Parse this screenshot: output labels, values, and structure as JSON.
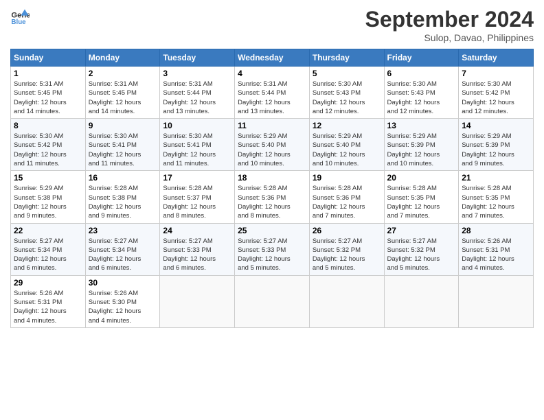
{
  "header": {
    "logo_line1": "General",
    "logo_line2": "Blue",
    "month": "September 2024",
    "location": "Sulop, Davao, Philippines"
  },
  "weekdays": [
    "Sunday",
    "Monday",
    "Tuesday",
    "Wednesday",
    "Thursday",
    "Friday",
    "Saturday"
  ],
  "weeks": [
    [
      {
        "day": "1",
        "sunrise": "5:31 AM",
        "sunset": "5:45 PM",
        "daylight": "12 hours and 14 minutes."
      },
      {
        "day": "2",
        "sunrise": "5:31 AM",
        "sunset": "5:45 PM",
        "daylight": "12 hours and 14 minutes."
      },
      {
        "day": "3",
        "sunrise": "5:31 AM",
        "sunset": "5:44 PM",
        "daylight": "12 hours and 13 minutes."
      },
      {
        "day": "4",
        "sunrise": "5:31 AM",
        "sunset": "5:44 PM",
        "daylight": "12 hours and 13 minutes."
      },
      {
        "day": "5",
        "sunrise": "5:30 AM",
        "sunset": "5:43 PM",
        "daylight": "12 hours and 12 minutes."
      },
      {
        "day": "6",
        "sunrise": "5:30 AM",
        "sunset": "5:43 PM",
        "daylight": "12 hours and 12 minutes."
      },
      {
        "day": "7",
        "sunrise": "5:30 AM",
        "sunset": "5:42 PM",
        "daylight": "12 hours and 12 minutes."
      }
    ],
    [
      {
        "day": "8",
        "sunrise": "5:30 AM",
        "sunset": "5:42 PM",
        "daylight": "12 hours and 11 minutes."
      },
      {
        "day": "9",
        "sunrise": "5:30 AM",
        "sunset": "5:41 PM",
        "daylight": "12 hours and 11 minutes."
      },
      {
        "day": "10",
        "sunrise": "5:30 AM",
        "sunset": "5:41 PM",
        "daylight": "12 hours and 11 minutes."
      },
      {
        "day": "11",
        "sunrise": "5:29 AM",
        "sunset": "5:40 PM",
        "daylight": "12 hours and 10 minutes."
      },
      {
        "day": "12",
        "sunrise": "5:29 AM",
        "sunset": "5:40 PM",
        "daylight": "12 hours and 10 minutes."
      },
      {
        "day": "13",
        "sunrise": "5:29 AM",
        "sunset": "5:39 PM",
        "daylight": "12 hours and 10 minutes."
      },
      {
        "day": "14",
        "sunrise": "5:29 AM",
        "sunset": "5:39 PM",
        "daylight": "12 hours and 9 minutes."
      }
    ],
    [
      {
        "day": "15",
        "sunrise": "5:29 AM",
        "sunset": "5:38 PM",
        "daylight": "12 hours and 9 minutes."
      },
      {
        "day": "16",
        "sunrise": "5:28 AM",
        "sunset": "5:38 PM",
        "daylight": "12 hours and 9 minutes."
      },
      {
        "day": "17",
        "sunrise": "5:28 AM",
        "sunset": "5:37 PM",
        "daylight": "12 hours and 8 minutes."
      },
      {
        "day": "18",
        "sunrise": "5:28 AM",
        "sunset": "5:36 PM",
        "daylight": "12 hours and 8 minutes."
      },
      {
        "day": "19",
        "sunrise": "5:28 AM",
        "sunset": "5:36 PM",
        "daylight": "12 hours and 7 minutes."
      },
      {
        "day": "20",
        "sunrise": "5:28 AM",
        "sunset": "5:35 PM",
        "daylight": "12 hours and 7 minutes."
      },
      {
        "day": "21",
        "sunrise": "5:28 AM",
        "sunset": "5:35 PM",
        "daylight": "12 hours and 7 minutes."
      }
    ],
    [
      {
        "day": "22",
        "sunrise": "5:27 AM",
        "sunset": "5:34 PM",
        "daylight": "12 hours and 6 minutes."
      },
      {
        "day": "23",
        "sunrise": "5:27 AM",
        "sunset": "5:34 PM",
        "daylight": "12 hours and 6 minutes."
      },
      {
        "day": "24",
        "sunrise": "5:27 AM",
        "sunset": "5:33 PM",
        "daylight": "12 hours and 6 minutes."
      },
      {
        "day": "25",
        "sunrise": "5:27 AM",
        "sunset": "5:33 PM",
        "daylight": "12 hours and 5 minutes."
      },
      {
        "day": "26",
        "sunrise": "5:27 AM",
        "sunset": "5:32 PM",
        "daylight": "12 hours and 5 minutes."
      },
      {
        "day": "27",
        "sunrise": "5:27 AM",
        "sunset": "5:32 PM",
        "daylight": "12 hours and 5 minutes."
      },
      {
        "day": "28",
        "sunrise": "5:26 AM",
        "sunset": "5:31 PM",
        "daylight": "12 hours and 4 minutes."
      }
    ],
    [
      {
        "day": "29",
        "sunrise": "5:26 AM",
        "sunset": "5:31 PM",
        "daylight": "12 hours and 4 minutes."
      },
      {
        "day": "30",
        "sunrise": "5:26 AM",
        "sunset": "5:30 PM",
        "daylight": "12 hours and 4 minutes."
      },
      null,
      null,
      null,
      null,
      null
    ]
  ],
  "label_sunrise": "Sunrise:",
  "label_sunset": "Sunset:",
  "label_daylight": "Daylight:"
}
